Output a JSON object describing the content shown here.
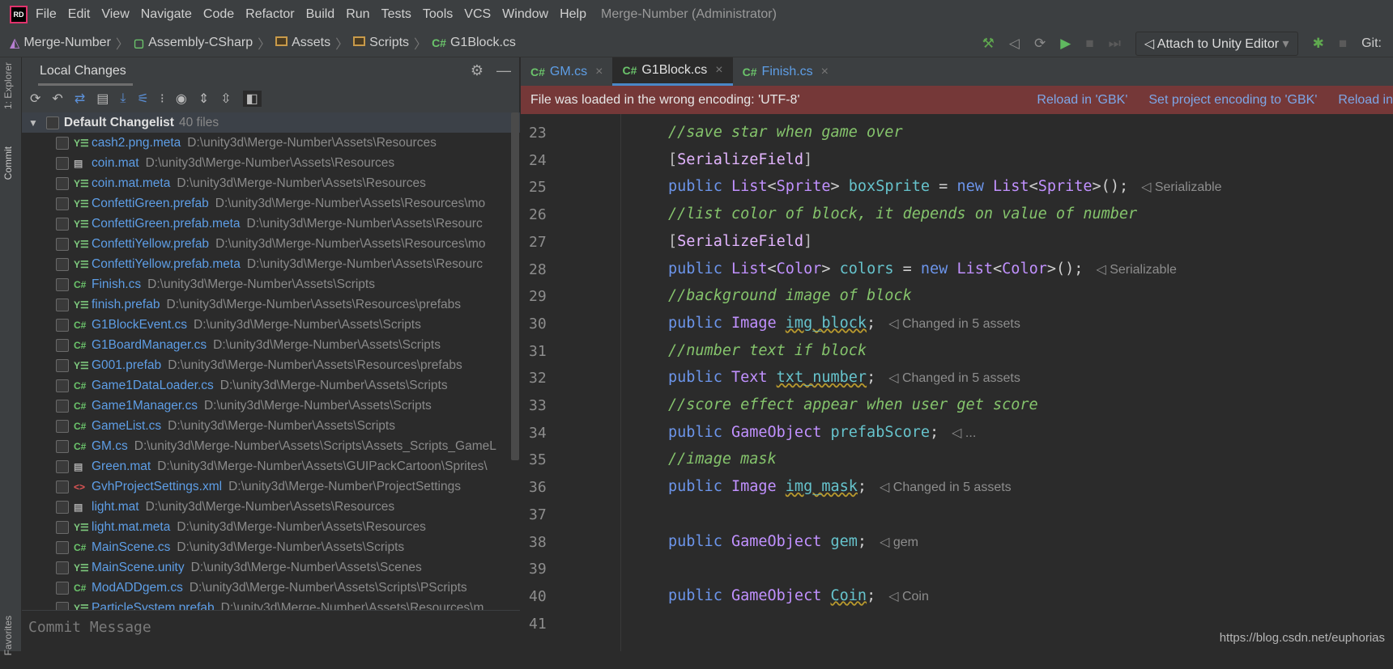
{
  "menu": {
    "items": [
      "File",
      "Edit",
      "View",
      "Navigate",
      "Code",
      "Refactor",
      "Build",
      "Run",
      "Tests",
      "Tools",
      "VCS",
      "Window",
      "Help"
    ],
    "window_title": "Merge-Number (Administrator)",
    "logo": "RD"
  },
  "breadcrumb": [
    "Merge-Number",
    "Assembly-CSharp",
    "Assets",
    "Scripts",
    "G1Block.cs"
  ],
  "toolbar": {
    "attach_label": "Attach to Unity Editor",
    "git_label": "Git:"
  },
  "side_tabs": {
    "explorer": "1: Explorer",
    "commit": "Commit",
    "favorites": "Favorites"
  },
  "left_panel": {
    "title": "Local Changes",
    "group": {
      "name": "Default Changelist",
      "count": "40 files"
    },
    "files": [
      {
        "name": "cash2.png.meta",
        "path": "D:\\unity3d\\Merge-Number\\Assets\\Resources",
        "type": "yaml"
      },
      {
        "name": "coin.mat",
        "path": "D:\\unity3d\\Merge-Number\\Assets\\Resources",
        "type": "mat"
      },
      {
        "name": "coin.mat.meta",
        "path": "D:\\unity3d\\Merge-Number\\Assets\\Resources",
        "type": "yaml"
      },
      {
        "name": "ConfettiGreen.prefab",
        "path": "D:\\unity3d\\Merge-Number\\Assets\\Resources\\mo",
        "type": "yaml"
      },
      {
        "name": "ConfettiGreen.prefab.meta",
        "path": "D:\\unity3d\\Merge-Number\\Assets\\Resourc",
        "type": "yaml"
      },
      {
        "name": "ConfettiYellow.prefab",
        "path": "D:\\unity3d\\Merge-Number\\Assets\\Resources\\mo",
        "type": "yaml"
      },
      {
        "name": "ConfettiYellow.prefab.meta",
        "path": "D:\\unity3d\\Merge-Number\\Assets\\Resourc",
        "type": "yaml"
      },
      {
        "name": "Finish.cs",
        "path": "D:\\unity3d\\Merge-Number\\Assets\\Scripts",
        "type": "cs"
      },
      {
        "name": "finish.prefab",
        "path": "D:\\unity3d\\Merge-Number\\Assets\\Resources\\prefabs",
        "type": "yaml"
      },
      {
        "name": "G1BlockEvent.cs",
        "path": "D:\\unity3d\\Merge-Number\\Assets\\Scripts",
        "type": "cs"
      },
      {
        "name": "G1BoardManager.cs",
        "path": "D:\\unity3d\\Merge-Number\\Assets\\Scripts",
        "type": "cs"
      },
      {
        "name": "G001.prefab",
        "path": "D:\\unity3d\\Merge-Number\\Assets\\Resources\\prefabs",
        "type": "yaml"
      },
      {
        "name": "Game1DataLoader.cs",
        "path": "D:\\unity3d\\Merge-Number\\Assets\\Scripts",
        "type": "cs"
      },
      {
        "name": "Game1Manager.cs",
        "path": "D:\\unity3d\\Merge-Number\\Assets\\Scripts",
        "type": "cs"
      },
      {
        "name": "GameList.cs",
        "path": "D:\\unity3d\\Merge-Number\\Assets\\Scripts",
        "type": "cs"
      },
      {
        "name": "GM.cs",
        "path": "D:\\unity3d\\Merge-Number\\Assets\\Scripts\\Assets_Scripts_GameL",
        "type": "cs"
      },
      {
        "name": "Green.mat",
        "path": "D:\\unity3d\\Merge-Number\\Assets\\GUIPackCartoon\\Sprites\\",
        "type": "mat"
      },
      {
        "name": "GvhProjectSettings.xml",
        "path": "D:\\unity3d\\Merge-Number\\ProjectSettings",
        "type": "xml"
      },
      {
        "name": "light.mat",
        "path": "D:\\unity3d\\Merge-Number\\Assets\\Resources",
        "type": "mat"
      },
      {
        "name": "light.mat.meta",
        "path": "D:\\unity3d\\Merge-Number\\Assets\\Resources",
        "type": "yaml"
      },
      {
        "name": "MainScene.cs",
        "path": "D:\\unity3d\\Merge-Number\\Assets\\Scripts",
        "type": "cs"
      },
      {
        "name": "MainScene.unity",
        "path": "D:\\unity3d\\Merge-Number\\Assets\\Scenes",
        "type": "yaml"
      },
      {
        "name": "ModADDgem.cs",
        "path": "D:\\unity3d\\Merge-Number\\Assets\\Scripts\\PScripts",
        "type": "cs"
      },
      {
        "name": "ParticleSystem.prefab",
        "path": "D:\\unity3d\\Merge-Number\\Assets\\Resources\\m",
        "type": "yaml"
      }
    ],
    "commit_placeholder": "Commit Message"
  },
  "editor": {
    "tabs": [
      {
        "label": "GM.cs",
        "active": false
      },
      {
        "label": "G1Block.cs",
        "active": true
      },
      {
        "label": "Finish.cs",
        "active": false
      }
    ],
    "banner": {
      "message": "File was loaded in the wrong encoding: 'UTF-8'",
      "links": [
        "Reload in 'GBK'",
        "Set project encoding to 'GBK'",
        "Reload in"
      ]
    },
    "lines": [
      {
        "n": "23",
        "tokens": [
          [
            "//save star when game over",
            "cm"
          ]
        ]
      },
      {
        "n": "24",
        "tokens": [
          [
            "[",
            "br"
          ],
          [
            "SerializeField",
            "at"
          ],
          [
            "]",
            "br"
          ]
        ]
      },
      {
        "n": "25",
        "tokens": [
          [
            "public ",
            "kw"
          ],
          [
            "List",
            "ty"
          ],
          [
            "<",
            "op"
          ],
          [
            "Sprite",
            "ty"
          ],
          [
            "> ",
            "op"
          ],
          [
            "boxSprite",
            "fd"
          ],
          [
            " = ",
            "op"
          ],
          [
            "new ",
            "kw"
          ],
          [
            "List",
            "ty"
          ],
          [
            "<",
            "op"
          ],
          [
            "Sprite",
            "ty"
          ],
          [
            ">();",
            "op"
          ]
        ],
        "hint": "Serializable"
      },
      {
        "n": "26",
        "tokens": [
          [
            "//list color of block, it depends on value of number",
            "cm"
          ]
        ]
      },
      {
        "n": "27",
        "tokens": [
          [
            "[",
            "br"
          ],
          [
            "SerializeField",
            "at"
          ],
          [
            "]",
            "br"
          ]
        ]
      },
      {
        "n": "28",
        "tokens": [
          [
            "public ",
            "kw"
          ],
          [
            "List",
            "ty"
          ],
          [
            "<",
            "op"
          ],
          [
            "Color",
            "ty"
          ],
          [
            "> ",
            "op"
          ],
          [
            "colors",
            "fd"
          ],
          [
            " = ",
            "op"
          ],
          [
            "new ",
            "kw"
          ],
          [
            "List",
            "ty"
          ],
          [
            "<",
            "op"
          ],
          [
            "Color",
            "ty"
          ],
          [
            ">();",
            "op"
          ]
        ],
        "hint": "Serializable"
      },
      {
        "n": "29",
        "tokens": [
          [
            "//background image of block",
            "cm"
          ]
        ]
      },
      {
        "n": "30",
        "tokens": [
          [
            "public ",
            "kw"
          ],
          [
            "Image ",
            "ty"
          ],
          [
            "img_block",
            "fdw"
          ],
          [
            ";",
            "op"
          ]
        ],
        "hint": "Changed in 5 assets"
      },
      {
        "n": "31",
        "tokens": [
          [
            "//number text if block",
            "cm"
          ]
        ]
      },
      {
        "n": "32",
        "tokens": [
          [
            "public ",
            "kw"
          ],
          [
            "Text ",
            "ty"
          ],
          [
            "txt_number",
            "fdw"
          ],
          [
            ";",
            "op"
          ]
        ],
        "hint": "Changed in 5 assets"
      },
      {
        "n": "33",
        "tokens": [
          [
            "//score effect appear when user get score",
            "cm"
          ]
        ]
      },
      {
        "n": "34",
        "tokens": [
          [
            "public ",
            "kw"
          ],
          [
            "GameObject ",
            "ty"
          ],
          [
            "prefabScore",
            "fd"
          ],
          [
            ";",
            "op"
          ]
        ],
        "hint": "..."
      },
      {
        "n": "35",
        "tokens": [
          [
            "//image mask",
            "cm"
          ]
        ]
      },
      {
        "n": "36",
        "tokens": [
          [
            "public ",
            "kw"
          ],
          [
            "Image ",
            "ty"
          ],
          [
            "img_mask",
            "fdw"
          ],
          [
            ";",
            "op"
          ]
        ],
        "hint": "Changed in 5 assets"
      },
      {
        "n": "37",
        "tokens": []
      },
      {
        "n": "38",
        "tokens": [
          [
            "public ",
            "kw"
          ],
          [
            "GameObject ",
            "ty"
          ],
          [
            "gem",
            "fd"
          ],
          [
            ";",
            "op"
          ]
        ],
        "hint": "gem"
      },
      {
        "n": "39",
        "tokens": []
      },
      {
        "n": "40",
        "tokens": [
          [
            "public ",
            "kw"
          ],
          [
            "GameObject ",
            "ty"
          ],
          [
            "Coin",
            "fdw"
          ],
          [
            ";",
            "op"
          ]
        ],
        "hint": "Coin"
      },
      {
        "n": "41",
        "tokens": []
      }
    ]
  },
  "watermark": "https://blog.csdn.net/euphorias",
  "colors": {
    "banner": "#753838",
    "keyword": "#6c95eb",
    "type": "#c191ff",
    "field": "#66c3cc",
    "comment": "#85c46c",
    "link": "#7da6e6"
  }
}
